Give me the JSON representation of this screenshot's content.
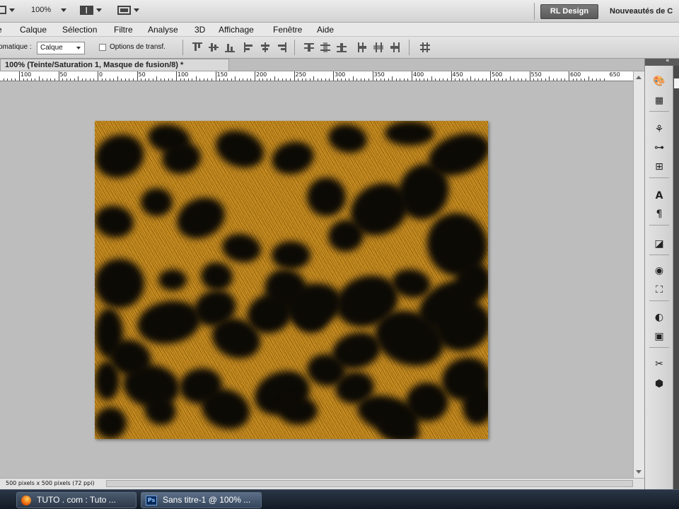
{
  "appbar": {
    "zoom": "100%",
    "workspace_button": "RL Design",
    "workspace_link": "Nouveautés de C"
  },
  "menu": [
    "Calque",
    "Sélection",
    "Filtre",
    "Analyse",
    "3D",
    "Affichage",
    "Fenêtre",
    "Aide"
  ],
  "options": {
    "auto_label": "omatique :",
    "auto_select_value": "Calque",
    "transform_label": "Options de transf."
  },
  "document": {
    "tab_title": "100% (Teinte/Saturation 1, Masque de fusion/8) *",
    "status": "500 pixels x 500 pixels (72 ppi)"
  },
  "ruler": {
    "labels": [
      "100",
      "50",
      "0",
      "50",
      "100",
      "150",
      "200",
      "250",
      "300",
      "350",
      "400",
      "450",
      "500",
      "550",
      "600",
      "650"
    ]
  },
  "panel_icons": [
    "palette-icon",
    "swatches-icon",
    "brush-presets-icon",
    "adjust-icon",
    "clone-source-icon",
    "character-icon",
    "paragraph-icon",
    "notes-icon",
    "3d-icon",
    "transform-icon",
    "mask-icon",
    "layer-comp-icon",
    "tools-icon",
    "actions-icon"
  ],
  "taskbar": {
    "items": [
      {
        "label": "TUTO . com : Tuto ...",
        "icon": "firefox-icon"
      },
      {
        "label": "Sans titre-1 @ 100% ...",
        "icon": "photoshop-icon"
      }
    ]
  },
  "colors": {
    "fur_base": "#c88c1e",
    "spot": "#0c0a05",
    "workspace_button": "#6a6a6a"
  }
}
